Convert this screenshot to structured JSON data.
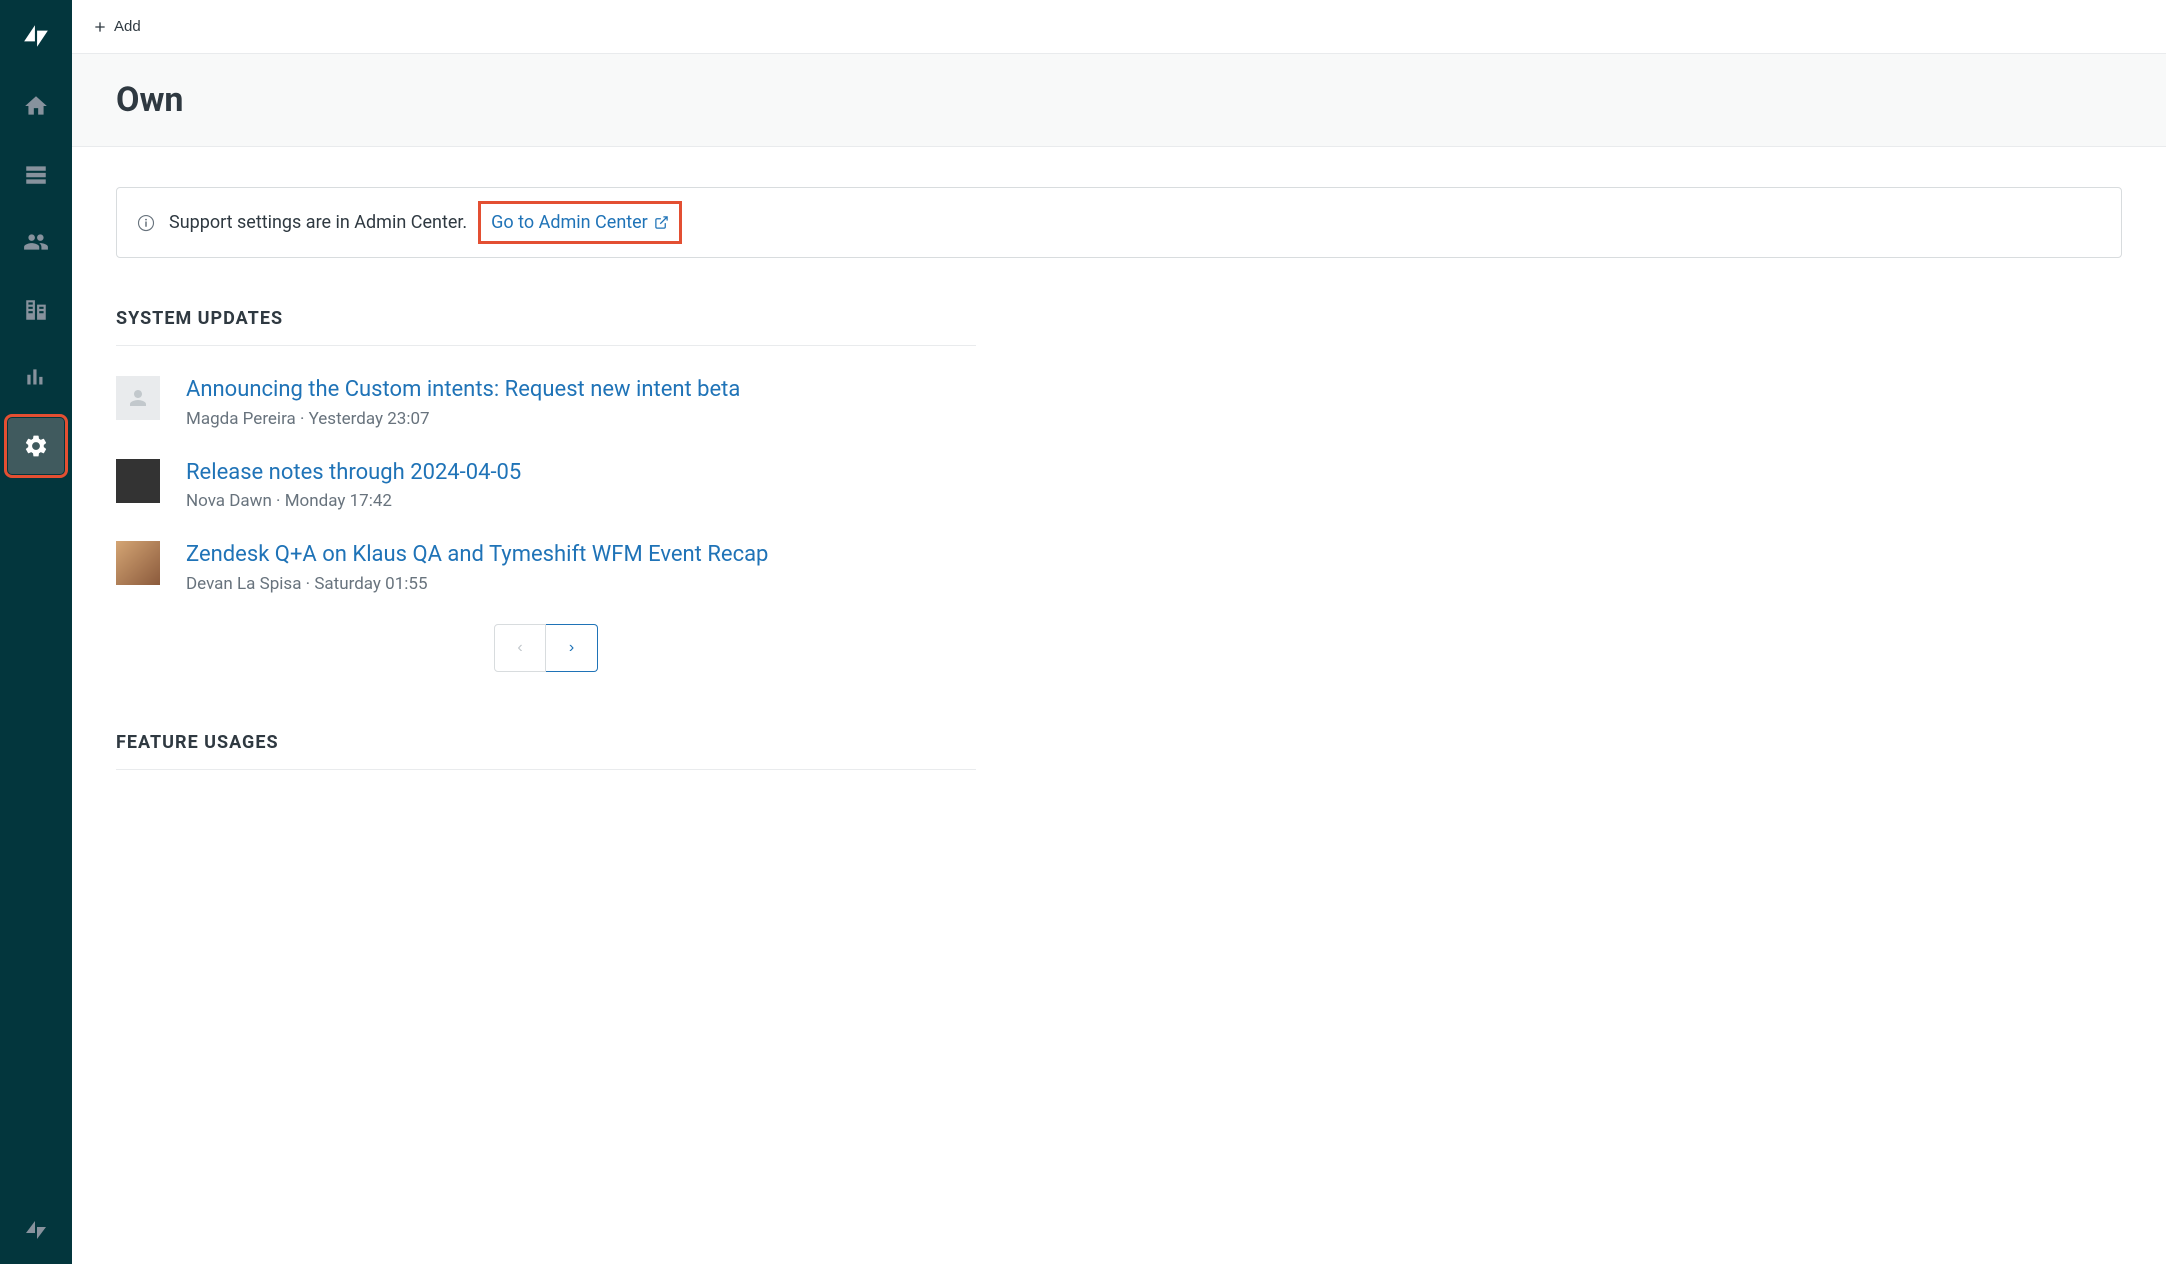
{
  "topbar": {
    "add_label": "Add"
  },
  "page": {
    "title": "Own"
  },
  "banner": {
    "text": "Support settings are in Admin Center.",
    "link_text": "Go to Admin Center"
  },
  "sections": {
    "system_updates": "SYSTEM UPDATES",
    "feature_usages": "FEATURE USAGES"
  },
  "updates": [
    {
      "title": "Announcing the Custom intents: Request new intent beta",
      "author": "Magda Pereira",
      "time": "Yesterday 23:07",
      "avatar_class": ""
    },
    {
      "title": "Release notes through 2024-04-05",
      "author": "Nova Dawn",
      "time": "Monday 17:42",
      "avatar_class": "photo1"
    },
    {
      "title": "Zendesk Q+A on Klaus QA and Tymeshift WFM Event Recap",
      "author": "Devan La Spisa",
      "time": "Saturday 01:55",
      "avatar_class": "photo2"
    }
  ]
}
